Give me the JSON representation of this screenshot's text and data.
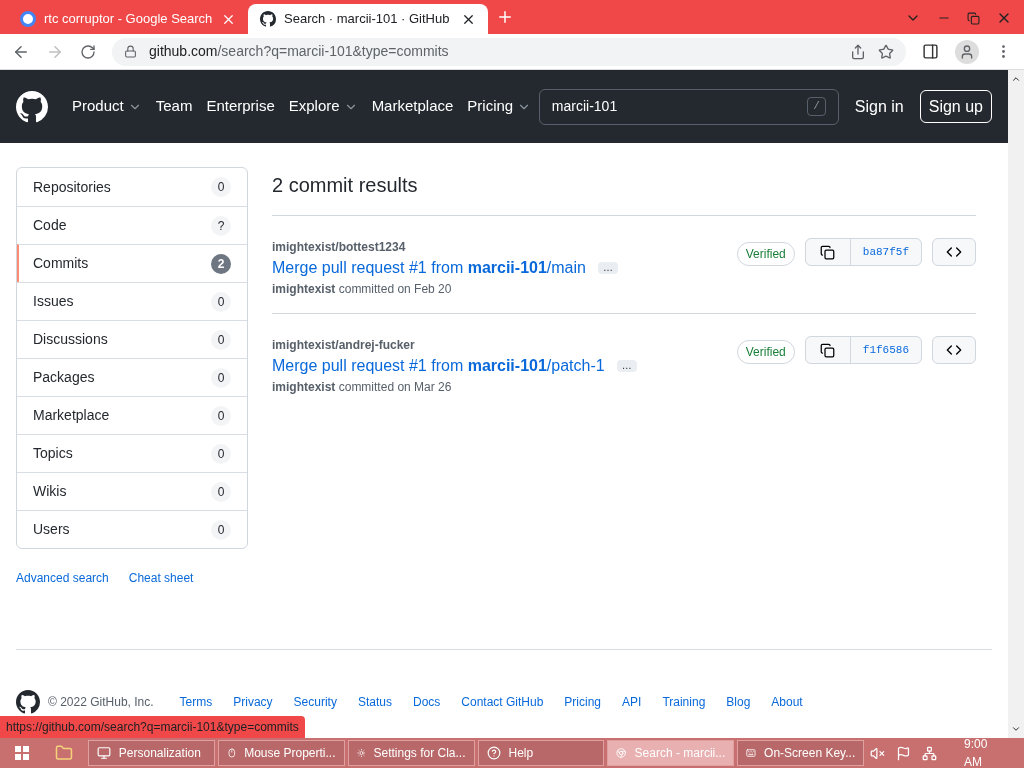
{
  "browser": {
    "tabs": [
      {
        "title": "rtc corruptor - Google Search",
        "selected": false
      },
      {
        "title": "Search · marcii-101 · GitHub",
        "selected": true
      }
    ],
    "url_host": "github.com",
    "url_path": "/search?q=marcii-101&type=commits"
  },
  "header": {
    "nav": [
      {
        "label": "Product",
        "dropdown": true
      },
      {
        "label": "Team",
        "dropdown": false
      },
      {
        "label": "Enterprise",
        "dropdown": false
      },
      {
        "label": "Explore",
        "dropdown": true
      },
      {
        "label": "Marketplace",
        "dropdown": false
      },
      {
        "label": "Pricing",
        "dropdown": true
      }
    ],
    "search_value": "marcii-101",
    "search_key": "/",
    "sign_in": "Sign in",
    "sign_up": "Sign up"
  },
  "sidebar": {
    "items": [
      {
        "label": "Repositories",
        "count": "0",
        "selected": false
      },
      {
        "label": "Code",
        "count": "?",
        "selected": false
      },
      {
        "label": "Commits",
        "count": "2",
        "selected": true
      },
      {
        "label": "Issues",
        "count": "0",
        "selected": false
      },
      {
        "label": "Discussions",
        "count": "0",
        "selected": false
      },
      {
        "label": "Packages",
        "count": "0",
        "selected": false
      },
      {
        "label": "Marketplace",
        "count": "0",
        "selected": false
      },
      {
        "label": "Topics",
        "count": "0",
        "selected": false
      },
      {
        "label": "Wikis",
        "count": "0",
        "selected": false
      },
      {
        "label": "Users",
        "count": "0",
        "selected": false
      }
    ],
    "links": [
      "Advanced search",
      "Cheat sheet"
    ]
  },
  "results": {
    "heading": "2 commit results",
    "commits": [
      {
        "repo": "imightexist/bottest1234",
        "title": "Merge pull request #1 from **marcii-101**/main",
        "more": "…",
        "author": "imightexist",
        "date": "committed on Feb 20",
        "badge": "Verified",
        "sha": "ba87f5f"
      },
      {
        "repo": "imightexist/andrej-fucker",
        "title": "Merge pull request #1 from **marcii-101**/patch-1",
        "more": "…",
        "author": "imightexist",
        "date": "committed on Mar 26",
        "badge": "Verified",
        "sha": "f1f6586"
      }
    ]
  },
  "footer": {
    "copyright": "© 2022 GitHub, Inc.",
    "links": [
      "Terms",
      "Privacy",
      "Security",
      "Status",
      "Docs",
      "Contact GitHub",
      "Pricing",
      "API",
      "Training",
      "Blog",
      "About"
    ]
  },
  "status_url": "https://github.com/search?q=marcii-101&type=commits",
  "taskbar": {
    "items": [
      {
        "label": "Personalization",
        "selected": false
      },
      {
        "label": "Mouse Properti...",
        "selected": false
      },
      {
        "label": "Settings for Cla...",
        "selected": false
      },
      {
        "label": "Help",
        "selected": false
      },
      {
        "label": "Search - marcii...",
        "selected": true
      },
      {
        "label": "On-Screen Key...",
        "selected": false
      }
    ],
    "time": "9:00 AM"
  }
}
